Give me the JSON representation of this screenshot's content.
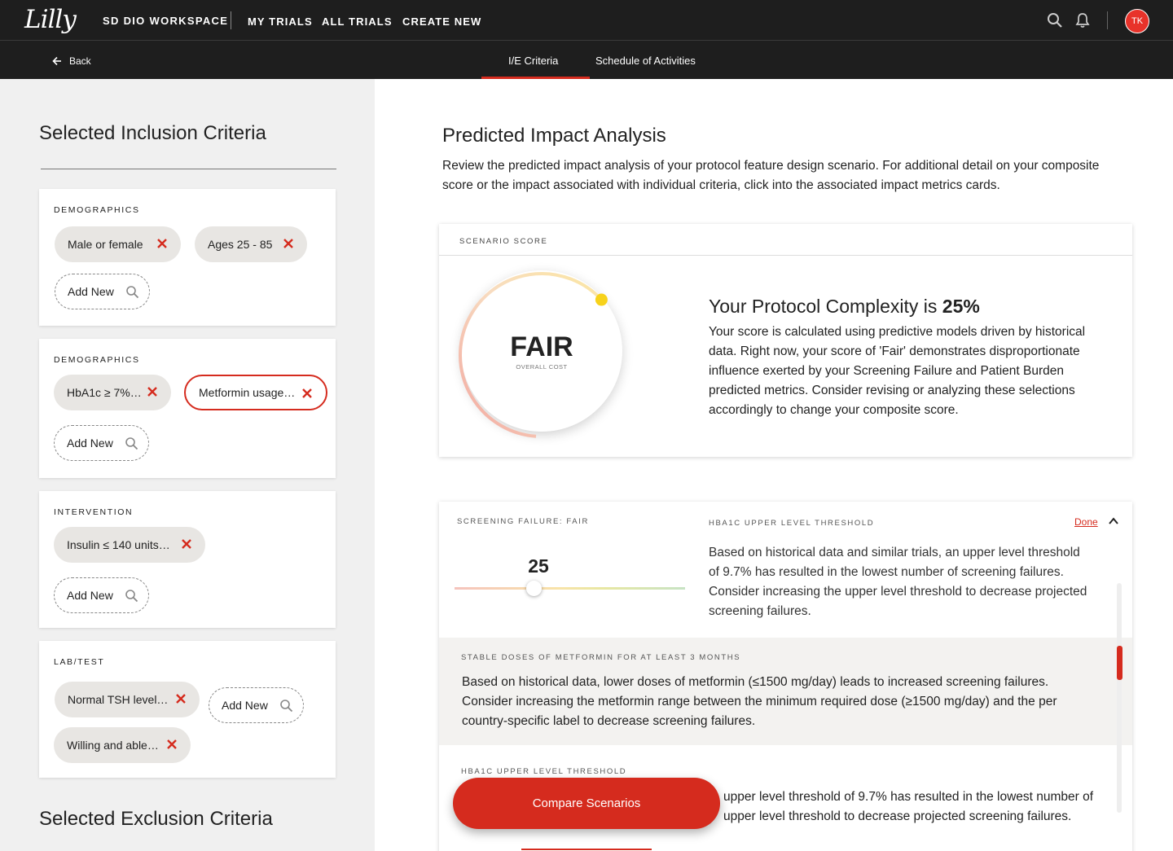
{
  "header": {
    "logo": "Lilly",
    "workspace": "SD DIO WORKSPACE",
    "nav": [
      "MY TRIALS",
      "ALL TRIALS",
      "CREATE NEW"
    ],
    "avatar_initials": "TK"
  },
  "subnav": {
    "back_label": "Back",
    "tabs": [
      "I/E Criteria",
      "Schedule of Activities"
    ],
    "active_tab": "I/E Criteria"
  },
  "left": {
    "inclusion_title": "Selected Inclusion Criteria",
    "exclusion_title": "Selected Exclusion Criteria",
    "add_new_label": "Add New",
    "cards": [
      {
        "title": "DEMOGRAPHICS",
        "chips": [
          "Male or female",
          "Ages 25 - 85"
        ]
      },
      {
        "title": "DEMOGRAPHICS",
        "chips": [
          "HbA1c ≥ 7%…",
          "Metformin usage…"
        ],
        "selected_chip": "Metformin usage…"
      },
      {
        "title": "INTERVENTION",
        "chips": [
          "Insulin ≤ 140 units…"
        ]
      },
      {
        "title": "LAB/TEST",
        "chips": [
          "Normal TSH level…",
          "Willing and able…"
        ]
      }
    ]
  },
  "main": {
    "title": "Predicted Impact Analysis",
    "description": "Review the predicted impact analysis of your protocol feature design scenario. For additional detail on your composite score or the impact associated with individual criteria, click into the associated impact metrics cards.",
    "scenario": {
      "label": "SCENARIO SCORE",
      "rating": "FAIR",
      "rating_sub": "OVERALL COST",
      "headline_prefix": "Your Protocol Complexity is ",
      "headline_value": "25%",
      "body": "Your score is calculated using predictive models driven by historical data. Right now, your score of 'Fair' demonstrates disproportionate influence exerted by your Screening Failure and Patient Burden predicted metrics. Consider revising or analyzing these selections accordingly to change your composite score.",
      "gauge_fraction": 0.62
    },
    "screening": {
      "label": "SCREENING FAILURE: FAIR",
      "value": "25",
      "slider_level": 0.25,
      "hba1c_label": "HBA1C UPPER LEVEL THRESHOLD",
      "done_label": "Done",
      "hba1c_body": "Based on historical data and similar trials, an upper level threshold of 9.7% has resulted in the lowest number of screening failures. Consider increasing the upper level threshold to decrease projected screening failures.",
      "metformin_label": "STABLE DOSES OF METFORMIN FOR AT LEAST 3 MONTHS",
      "metformin_body": "Based on historical data, lower doses of metformin (≤1500 mg/day) leads to increased screening failures. Consider increasing the metformin range between the minimum required dose (≥1500 mg/day) and the per country-specific label to decrease screening failures.",
      "hba1c2_label": "HBA1C UPPER LEVEL THRESHOLD",
      "hba1c2_body": "upper level threshold of 9.7% has resulted in the lowest number of upper level threshold to decrease projected screening failures."
    },
    "compare_label": "Compare Scenarios"
  },
  "colors": {
    "brand_red": "#d52b1e",
    "nav_bg": "#1e1e1e",
    "gauge_dot": "#f7d21b"
  },
  "icons": [
    "search-icon",
    "bell-icon",
    "arrow-left-icon",
    "close-icon",
    "chevron-up-icon"
  ]
}
